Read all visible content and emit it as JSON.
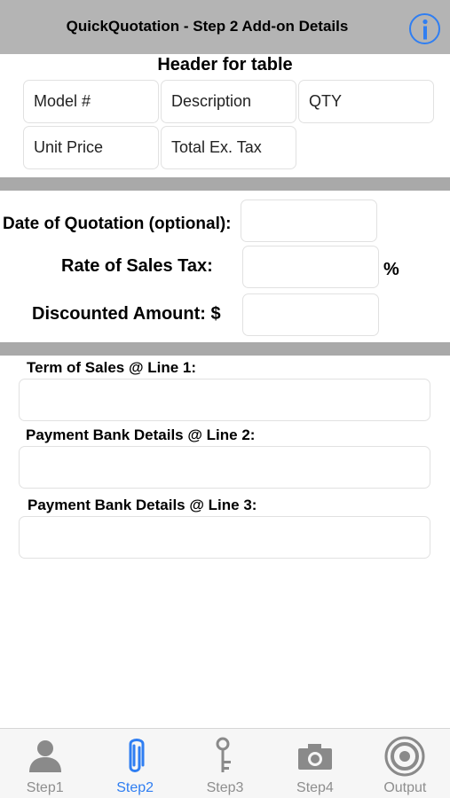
{
  "header": {
    "title": "QuickQuotation - Step 2 Add-on Details",
    "info_icon": "info-circle-icon"
  },
  "table_header": {
    "title": "Header for table",
    "fields": [
      "Model #",
      "Description",
      "QTY",
      "Unit Price",
      "Total Ex. Tax"
    ]
  },
  "quotation": {
    "date_label": "Date of Quotation (optional):",
    "date_value": "",
    "tax_label": "Rate of Sales Tax:",
    "tax_value": "",
    "tax_unit": "%",
    "discount_label": "Discounted Amount: $",
    "discount_value": ""
  },
  "terms": {
    "line1_label": "Term of Sales @ Line 1:",
    "line1_value": "",
    "line2_label": "Payment Bank Details @ Line 2:",
    "line2_value": "",
    "line3_label": "Payment Bank Details @ Line 3:",
    "line3_value": ""
  },
  "tabs": [
    {
      "label": "Step1",
      "icon": "person-icon"
    },
    {
      "label": "Step2",
      "icon": "paperclip-icon",
      "active": true
    },
    {
      "label": "Step3",
      "icon": "key-icon"
    },
    {
      "label": "Step4",
      "icon": "camera-icon"
    },
    {
      "label": "Output",
      "icon": "target-icon"
    }
  ],
  "colors": {
    "accent": "#2f7ef2",
    "navbar": "#b4b4b4",
    "divider": "#a9a9a9",
    "tab_inactive": "#8e8e8e"
  }
}
